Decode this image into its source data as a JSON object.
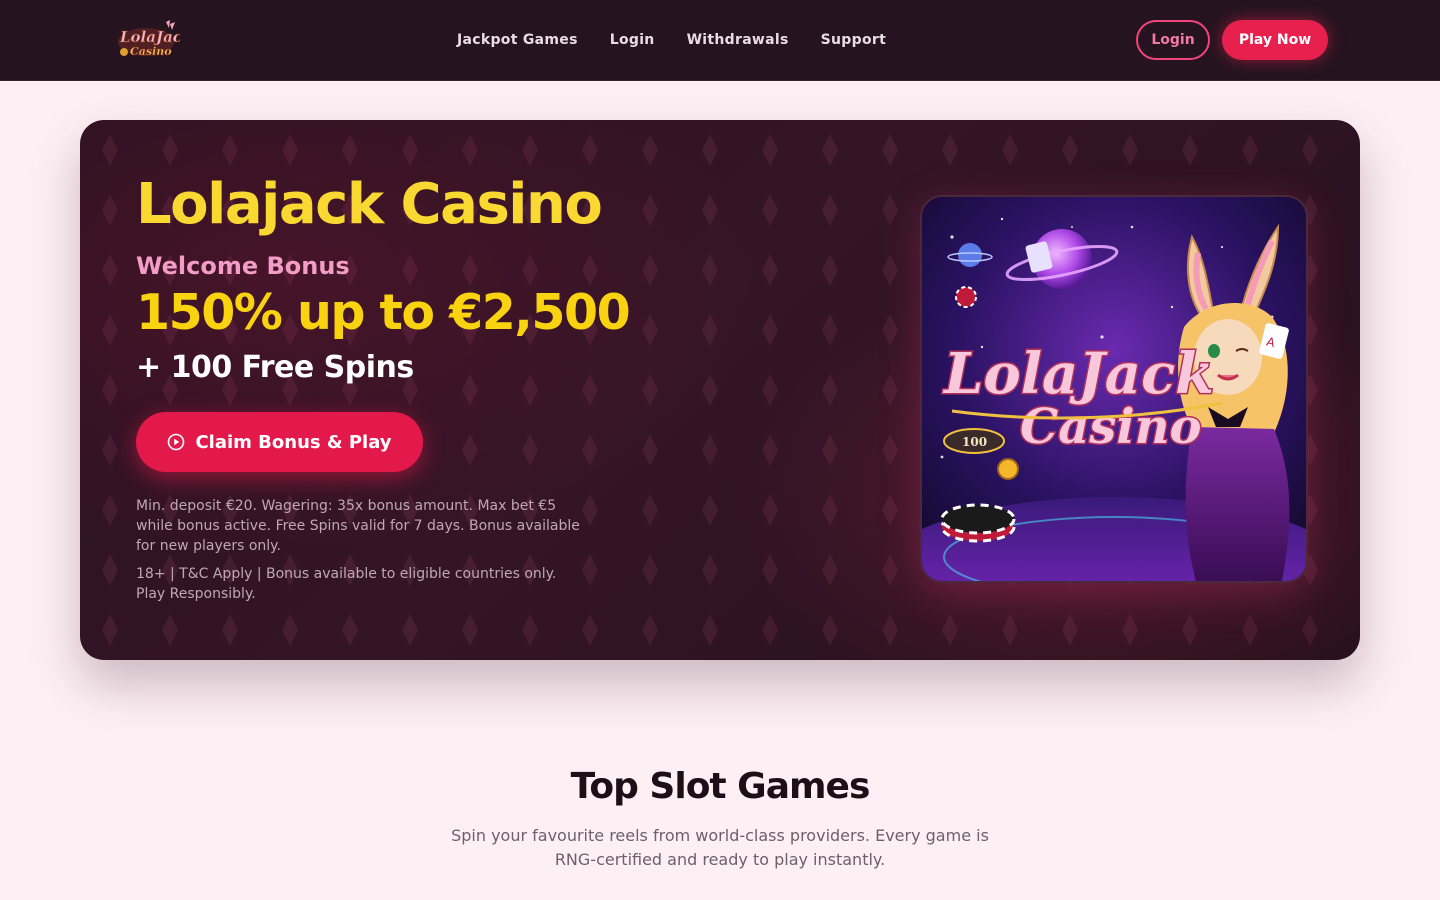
{
  "header": {
    "logo_alt": "LolaJack Casino",
    "nav": [
      "Jackpot Games",
      "Login",
      "Withdrawals",
      "Support"
    ],
    "login_label": "Login",
    "play_label": "Play Now"
  },
  "hero": {
    "title": "Lolajack Casino",
    "kicker": "Welcome Bonus",
    "offer": "150% up to €2,500",
    "spins": "+ 100 Free Spins",
    "cta_label": "Claim Bonus & Play",
    "terms": "Min. deposit €20. Wagering: 35x bonus amount. Max bet €5 while bonus active. Free Spins valid for 7 days. Bonus available for new players only.",
    "disclaimer": "18+ | T&C Apply | Bonus available to eligible countries only. Play Responsibly.",
    "art_text_line1": "LolaJack",
    "art_text_line2": "Casino",
    "art_chip_value": "100"
  },
  "section": {
    "title": "Top Slot Games",
    "subtitle": "Spin your favourite reels from world-class providers. Every game is RNG-certified and ready to play instantly."
  },
  "colors": {
    "header_bg": "#25141f",
    "accent_pink": "#e8204e",
    "accent_yellow": "#f9d832",
    "page_bg": "#fdf0f4"
  }
}
